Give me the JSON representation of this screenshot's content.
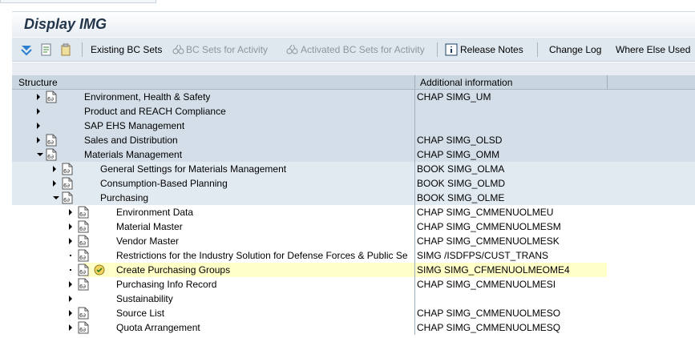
{
  "window": {
    "title": "Display IMG"
  },
  "toolbar": {
    "existing_bc_sets": "Existing BC Sets",
    "bc_sets_activity": "BC Sets for Activity",
    "activated_bc_sets": "Activated BC Sets for Activity",
    "release_notes": "Release Notes",
    "change_log": "Change Log",
    "where_else_used": "Where Else Used"
  },
  "columns": {
    "structure": "Structure",
    "additional": "Additional information"
  },
  "tree": [
    {
      "label": "Environment, Health & Safety",
      "info": "CHAP SIMG_UM",
      "level": 1,
      "expander": "right",
      "doc": true
    },
    {
      "label": "Product and REACH Compliance",
      "info": "",
      "level": 1,
      "expander": "right",
      "doc": false
    },
    {
      "label": "SAP EHS Management",
      "info": "",
      "level": 1,
      "expander": "right",
      "doc": false
    },
    {
      "label": "Sales and Distribution",
      "info": "CHAP SIMG_OLSD",
      "level": 1,
      "expander": "right",
      "doc": true
    },
    {
      "label": "Materials Management",
      "info": "CHAP SIMG_OMM",
      "level": 1,
      "expander": "down",
      "doc": true
    },
    {
      "label": "General Settings for Materials Management",
      "info": "BOOK SIMG_OLMA",
      "level": 2,
      "expander": "right",
      "doc": true
    },
    {
      "label": "Consumption-Based Planning",
      "info": "BOOK SIMG_OLMD",
      "level": 2,
      "expander": "right",
      "doc": true
    },
    {
      "label": "Purchasing",
      "info": "BOOK SIMG_OLME",
      "level": 2,
      "expander": "down",
      "doc": true
    },
    {
      "label": "Environment Data",
      "info": "CHAP SIMG_CMMENUOLMEU",
      "level": 3,
      "expander": "right",
      "doc": true
    },
    {
      "label": "Material Master",
      "info": "CHAP SIMG_CMMENUOLMESM",
      "level": 3,
      "expander": "right",
      "doc": true
    },
    {
      "label": "Vendor Master",
      "info": "CHAP SIMG_CMMENUOLMESK",
      "level": 3,
      "expander": "right",
      "doc": true
    },
    {
      "label": "Restrictions for the Industry Solution for Defense Forces & Public Se",
      "info": "SIMG /ISDFPS/CUST_TRANS",
      "level": 3,
      "expander": "dot",
      "doc": true
    },
    {
      "label": "Create Purchasing Groups",
      "info": "SIMG SIMG_CFMENUOLMEOME4",
      "level": 3,
      "expander": "dot",
      "doc": true,
      "exec": true,
      "selected": true
    },
    {
      "label": "Purchasing Info Record",
      "info": "CHAP SIMG_CMMENUOLMESI",
      "level": 3,
      "expander": "right",
      "doc": true
    },
    {
      "label": "Sustainability",
      "info": "",
      "level": 3,
      "expander": "right",
      "doc": false
    },
    {
      "label": "Source List",
      "info": "CHAP SIMG_CMMENUOLMESO",
      "level": 3,
      "expander": "right",
      "doc": true
    },
    {
      "label": "Quota Arrangement",
      "info": "CHAP SIMG_CMMENUOLMESQ",
      "level": 3,
      "expander": "right",
      "doc": true
    }
  ]
}
